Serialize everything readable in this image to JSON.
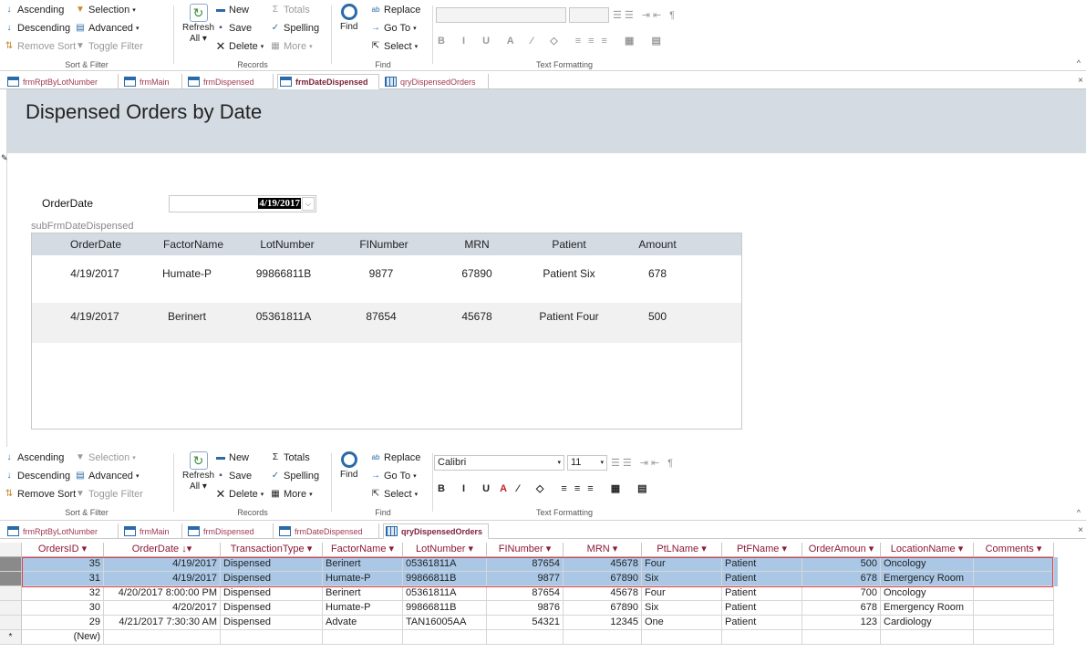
{
  "ribbon": {
    "sort_filter": {
      "ascending": "Ascending",
      "descending": "Descending",
      "remove_sort": "Remove Sort",
      "selection": "Selection",
      "advanced": "Advanced",
      "toggle_filter": "Toggle Filter",
      "group_label": "Sort & Filter"
    },
    "records": {
      "refresh": "Refresh",
      "refresh_all": "All",
      "new": "New",
      "save": "Save",
      "delete": "Delete",
      "totals": "Totals",
      "spelling": "Spelling",
      "more": "More",
      "group_label": "Records"
    },
    "find": {
      "find": "Find",
      "replace": "Replace",
      "go_to": "Go To",
      "select": "Select",
      "group_label": "Find"
    },
    "text_formatting": {
      "group_label": "Text Formatting",
      "font_top": "",
      "size_top": "",
      "font_bottom": "Calibri",
      "size_bottom": "11"
    }
  },
  "tabs_top": [
    "frmRptByLotNumber",
    "frmMain",
    "frmDispensed",
    "frmDateDispensed",
    "qryDispensedOrders"
  ],
  "tabs_bottom": [
    "frmRptByLotNumber",
    "frmMain",
    "frmDispensed",
    "frmDateDispensed",
    "qryDispensedOrders"
  ],
  "form": {
    "title": "Dispensed Orders by Date",
    "order_date_label": "OrderDate",
    "order_date_value": "4/19/2017",
    "subform_label": "subFrmDateDispensed",
    "sub_headers": [
      "OrderDate",
      "FactorName",
      "LotNumber",
      "FINumber",
      "MRN",
      "Patient",
      "Amount"
    ],
    "sub_rows": [
      [
        "4/19/2017",
        "Humate-P",
        "99866811B",
        "9877",
        "67890",
        "Patient Six",
        "678"
      ],
      [
        "4/19/2017",
        "Berinert",
        "05361811A",
        "87654",
        "45678",
        "Patient Four",
        "500"
      ]
    ]
  },
  "datasheet": {
    "headers": [
      "OrdersID",
      "OrderDate",
      "TransactionType",
      "FactorName",
      "LotNumber",
      "FINumber",
      "MRN",
      "PtLName",
      "PtFName",
      "OrderAmoun",
      "LocationName",
      "Comments"
    ],
    "rows": [
      [
        "35",
        "4/19/2017",
        "Dispensed",
        "Berinert",
        "05361811A",
        "87654",
        "45678",
        "Four",
        "Patient",
        "500",
        "Oncology",
        ""
      ],
      [
        "31",
        "4/19/2017",
        "Dispensed",
        "Humate-P",
        "99866811B",
        "9877",
        "67890",
        "Six",
        "Patient",
        "678",
        "Emergency Room",
        ""
      ],
      [
        "32",
        "4/20/2017 8:00:00 PM",
        "Dispensed",
        "Berinert",
        "05361811A",
        "87654",
        "45678",
        "Four",
        "Patient",
        "700",
        "Oncology",
        ""
      ],
      [
        "30",
        "4/20/2017",
        "Dispensed",
        "Humate-P",
        "99866811B",
        "9876",
        "67890",
        "Six",
        "Patient",
        "678",
        "Emergency Room",
        ""
      ],
      [
        "29",
        "4/21/2017 7:30:30 AM",
        "Dispensed",
        "Advate",
        "TAN16005AA",
        "54321",
        "12345",
        "One",
        "Patient",
        "123",
        "Cardiology",
        ""
      ]
    ],
    "new_row": "(New)",
    "new_marker": "*"
  }
}
